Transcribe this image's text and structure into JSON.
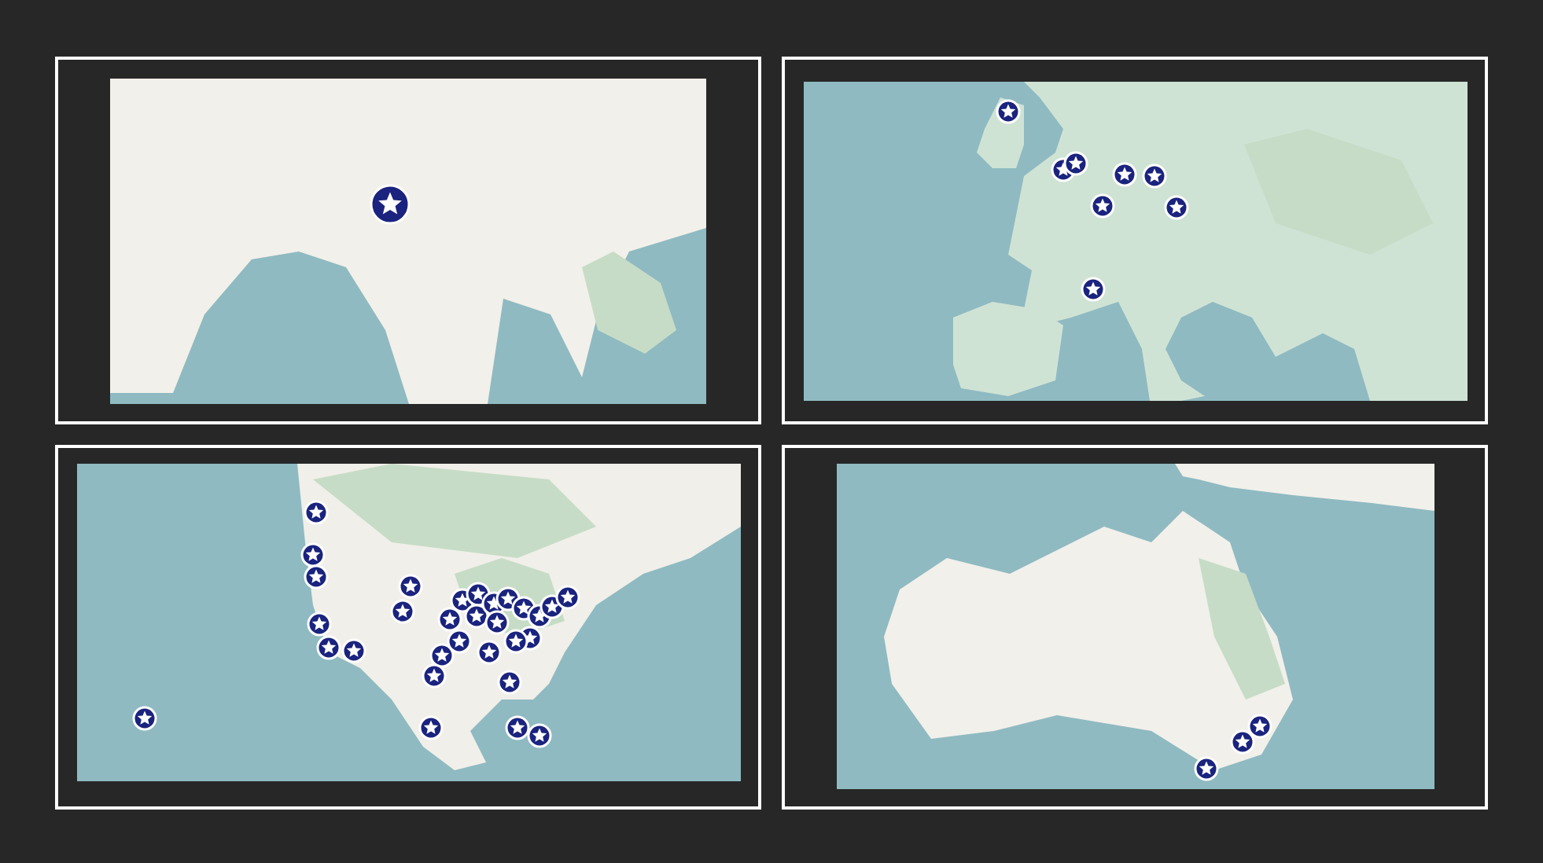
{
  "panels": [
    {
      "markers": [
        {
          "large": true
        }
      ]
    },
    {
      "markers": [
        {
          "large": false
        },
        {
          "large": false
        },
        {
          "large": false
        },
        {
          "large": false
        },
        {
          "large": false
        },
        {
          "large": false
        },
        {
          "large": false
        },
        {
          "large": false
        }
      ]
    },
    {
      "markers": [
        {
          "large": false
        },
        {
          "large": false
        },
        {
          "large": false
        },
        {
          "large": false
        },
        {
          "large": false
        },
        {
          "large": false
        },
        {
          "large": false
        },
        {
          "large": false
        },
        {
          "large": false
        },
        {
          "large": false
        },
        {
          "large": false
        },
        {
          "large": false
        },
        {
          "large": false
        },
        {
          "large": false
        },
        {
          "large": false
        },
        {
          "large": false
        },
        {
          "large": false
        },
        {
          "large": false
        },
        {
          "large": false
        },
        {
          "large": false
        },
        {
          "large": false
        },
        {
          "large": false
        },
        {
          "large": false
        },
        {
          "large": false
        },
        {
          "large": false
        },
        {
          "large": false
        },
        {
          "large": false
        },
        {
          "large": false
        },
        {
          "large": false
        },
        {
          "large": false
        }
      ]
    },
    {
      "markers": [
        {
          "large": false
        },
        {
          "large": false
        },
        {
          "large": false
        }
      ]
    }
  ]
}
